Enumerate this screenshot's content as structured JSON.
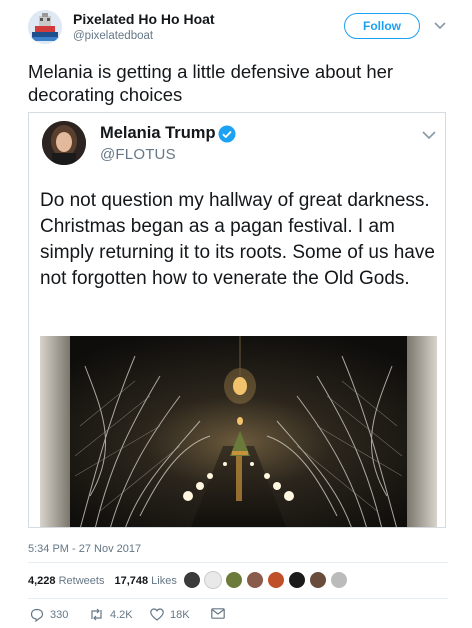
{
  "user": {
    "display_name": "Pixelated Ho Ho Hoat",
    "handle": "@pixelatedboat",
    "follow_label": "Follow"
  },
  "tweet": {
    "text": "Melania is getting a little defensive about her decorating choices",
    "timestamp": "5:34 PM - 27 Nov 2017"
  },
  "embedded": {
    "display_name": "Melania Trump",
    "handle": "@FLOTUS",
    "text": "Do not question my hallway of great darkness. Christmas began as a pagan festival. I am simply returning it to its roots. Some of us have not forgotten how to venerate the Old Gods."
  },
  "stats": {
    "retweets_count": "4,228",
    "retweets_label": "Retweets",
    "likes_count": "17,748",
    "likes_label": "Likes"
  },
  "actions": {
    "reply_count": "330",
    "retweet_count": "4.2K",
    "like_count": "18K"
  },
  "colors": {
    "accent": "#1da1f2",
    "muted": "#657786",
    "text": "#14171a"
  }
}
